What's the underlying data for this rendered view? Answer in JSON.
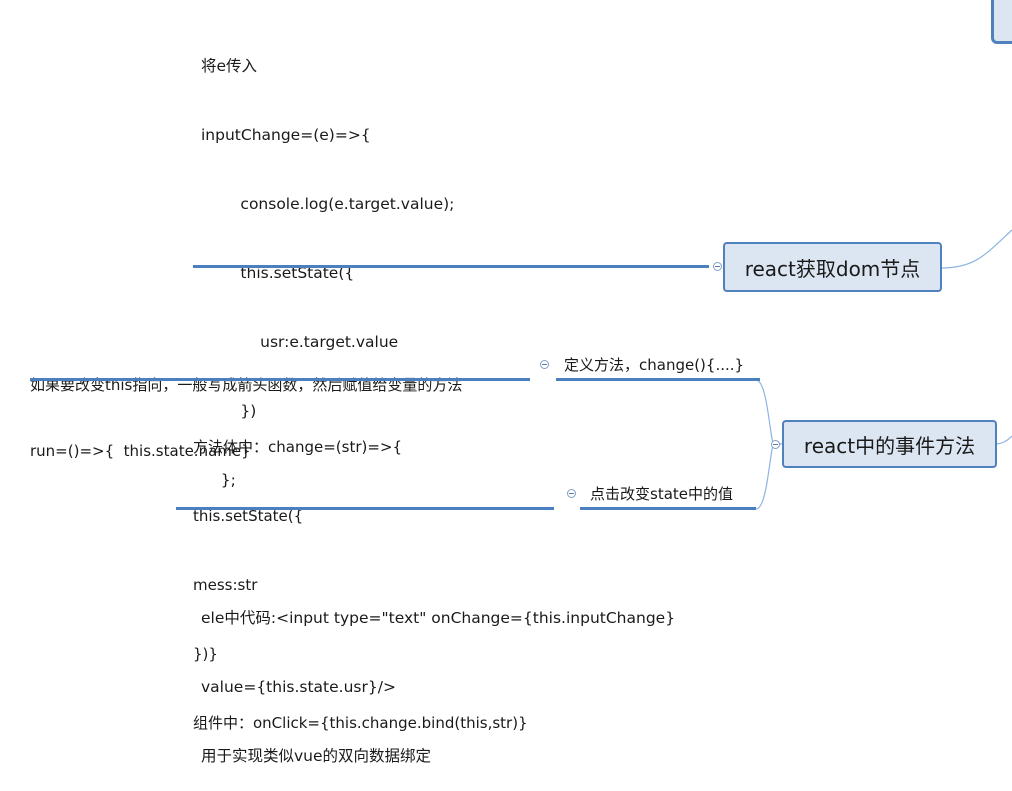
{
  "top_note": {
    "lines": [
      "将e传入",
      "inputChange=(e)=>{",
      "        console.log(e.target.value);",
      "        this.setState({",
      "            usr:e.target.value",
      "        })",
      "    };",
      "",
      "ele中代码:<input type=\"text\" onChange={this.inputChange}",
      "value={this.state.usr}/>",
      "用于实现类似vue的双向数据绑定"
    ]
  },
  "node_dom": {
    "label": "react获取dom节点"
  },
  "node_event": {
    "label": "react中的事件方法"
  },
  "define_branch": {
    "label": "定义方法，change(){....}",
    "note_lines": [
      "如果要改变this指向，一般写成箭头函数，然后赋值给变量的方法",
      "run=()=>{  this.state.name}"
    ]
  },
  "click_branch": {
    "label": "点击改变state中的值",
    "note_lines": [
      "方法体中：change=(str)=>{",
      "this.setState({",
      "mess:str",
      "})}",
      "组件中：onClick={this.change.bind(this,str)}"
    ]
  },
  "colors": {
    "node_fill": "#dce6f2",
    "node_border": "#4f81bd",
    "connector": "#4a7fc0",
    "curve": "#8eb4e3"
  }
}
